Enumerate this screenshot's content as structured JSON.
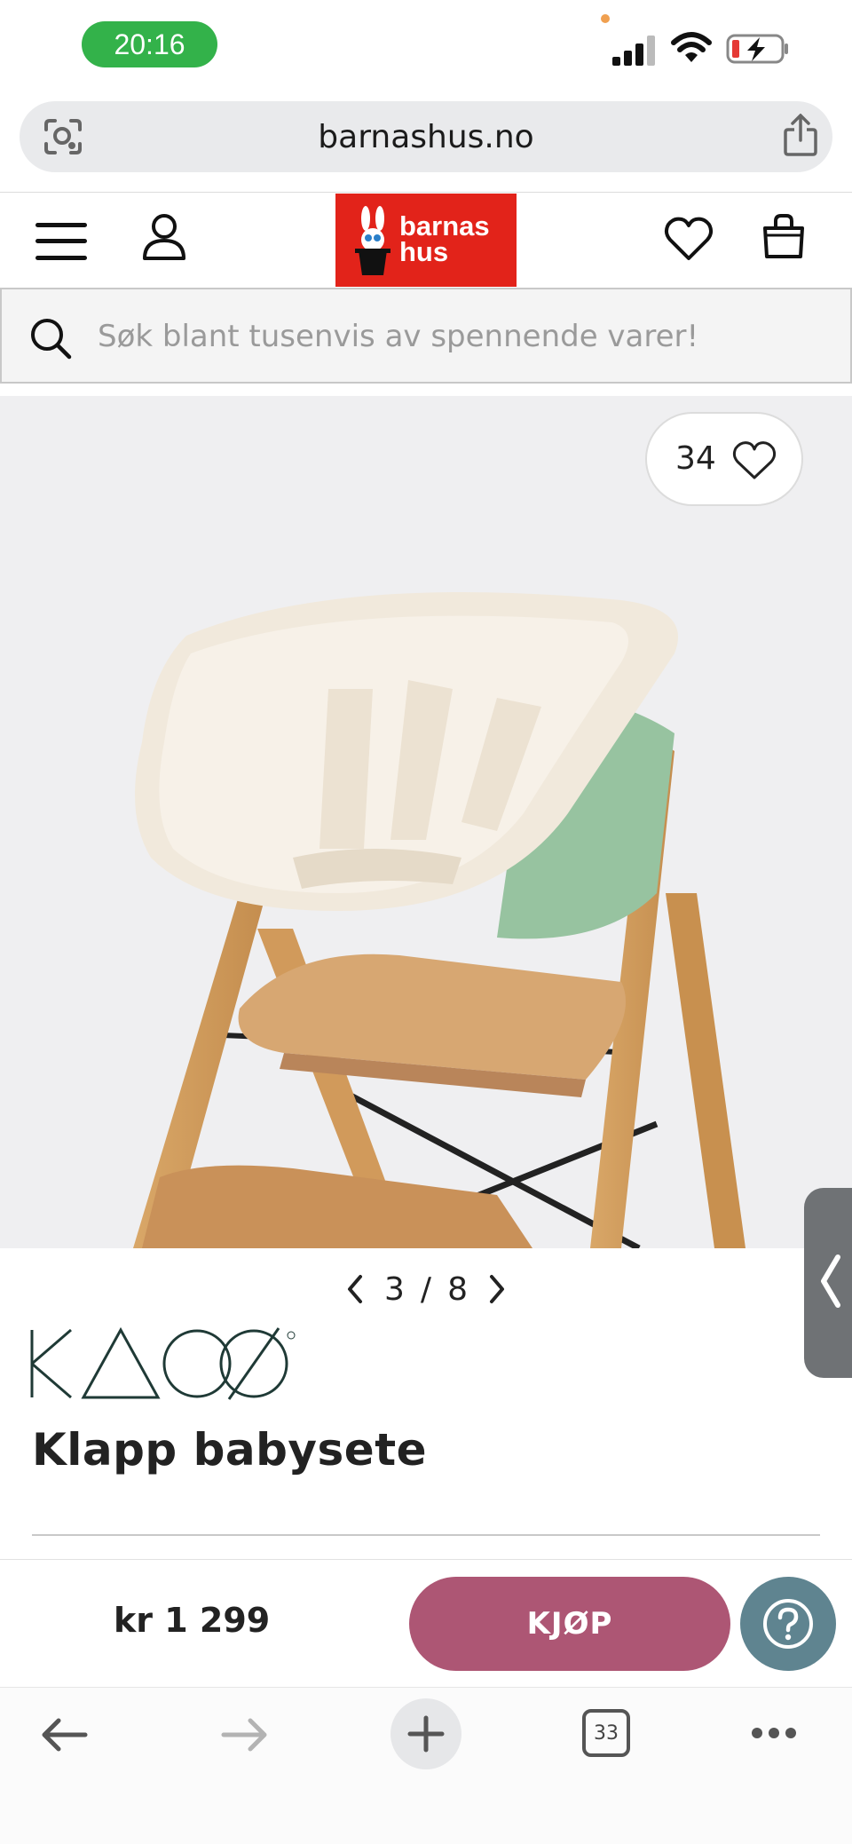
{
  "status_bar": {
    "time": "20:16"
  },
  "browser": {
    "url": "barnashus.no",
    "tab_count": "33"
  },
  "site": {
    "logo_text_line1": "barnas",
    "logo_text_line2": "hus",
    "search_placeholder": "Søk blant tusenvis av spennende varer!"
  },
  "product": {
    "like_count": "34",
    "gallery_current": "3",
    "gallery_separator": "/",
    "gallery_total": "8",
    "brand": "KAOS",
    "title": "Klapp babysete",
    "price": "kr 1 299",
    "buy_label": "KJØP"
  },
  "colors": {
    "time_pill": "#33b24a",
    "logo_red": "#e2231a",
    "buy_button": "#ad5674",
    "help_button": "#5f8490"
  }
}
